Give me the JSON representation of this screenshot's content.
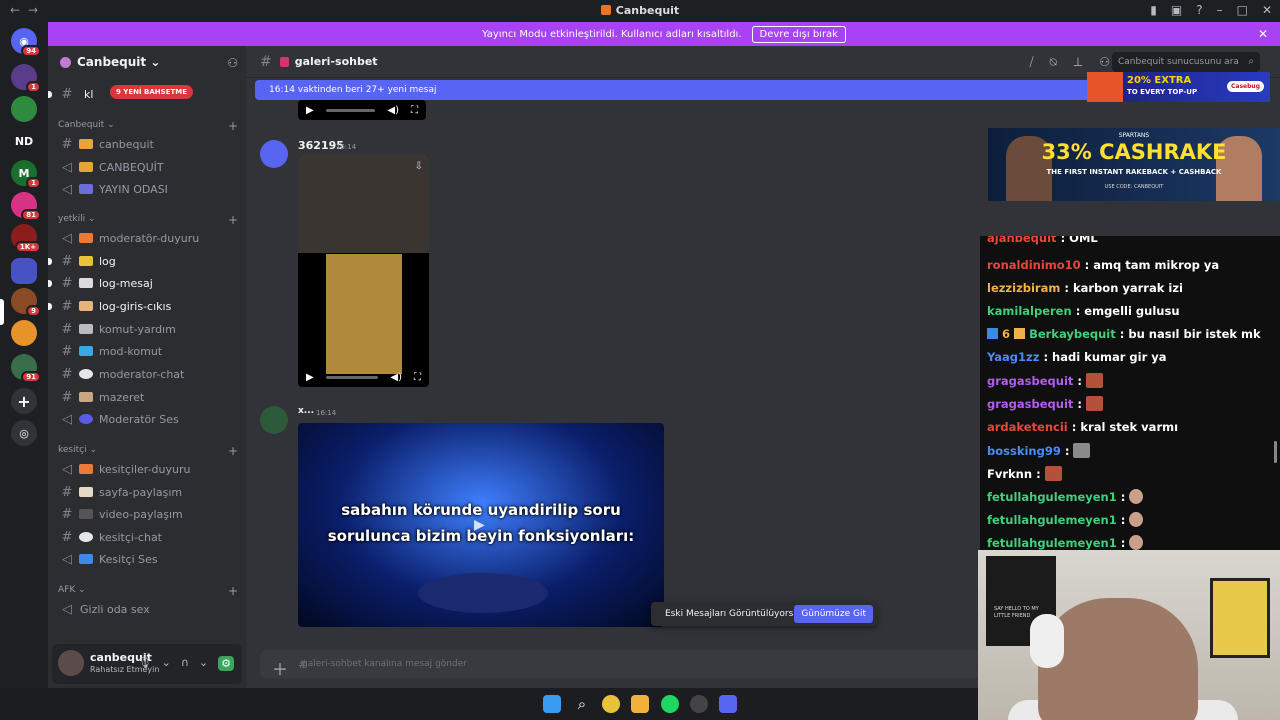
{
  "window": {
    "title": "Canbequit"
  },
  "banner": {
    "text": "Yayıncı Modu etkinleştirildi. Kullanıcı adları kısaltıldı.",
    "button": "Devre dışı bırak"
  },
  "rail": {
    "badges": [
      "94",
      "1",
      "1",
      "81",
      "1K+",
      "9",
      "91"
    ],
    "nd_label": "ND"
  },
  "server": {
    "name": "Canbequit",
    "new_badge": "9 YENİ BAHSETME",
    "first_channel_stub": "kl",
    "categories": [
      {
        "name": "Canbequit",
        "channels": [
          "canbequit",
          "CANBEQUİT",
          "YAYIN ODASI"
        ]
      },
      {
        "name": "yetkili",
        "channels": [
          "moderatör-duyuru",
          "log",
          "log-mesaj",
          "log-giris-cıkıs",
          "komut-yardım",
          "mod-komut",
          "moderator-chat",
          "mazeret",
          "Moderatör Ses"
        ]
      },
      {
        "name": "kesitçi",
        "channels": [
          "kesitçiler-duyuru",
          "sayfa-paylaşım",
          "video-paylaşım",
          "kesitçi-chat",
          "Kesitçi Ses"
        ]
      },
      {
        "name": "AFK",
        "channels": [
          "Gizli oda sex"
        ]
      }
    ]
  },
  "user": {
    "name": "canbequit",
    "status": "Rahatsız Etmeyin"
  },
  "channel": {
    "name": "galeri-sohbet",
    "search_placeholder": "Canbequit sunucusunu ara",
    "new_messages_bar": "16:14 vaktinden beri 27+ yeni mesaj"
  },
  "messages": [
    {
      "author": "362195",
      "time": "16:14"
    },
    {
      "author": "x...",
      "time": "16:14",
      "video_caption": "sabahın körunde uyandirilip soru sorulunca bizim beyin fonksiyonları:"
    }
  ],
  "jump": {
    "text": "Eski Mesajları Görüntülüyorsun",
    "button": "Günümüze Git"
  },
  "composer": {
    "placeholder": "galeri-sohbet kanalına mesaj gönder"
  },
  "ads": {
    "top": {
      "headline": "20% EXTRA",
      "sub": "TO EVERY TOP-UP",
      "brand": "Casebug"
    },
    "main": {
      "brand": "SPARTANS",
      "headline": "33% CASHRAKE",
      "sub": "THE FIRST INSTANT RAKEBACK + CASHBACK",
      "code": "USE CODE: CANBEQUIT"
    }
  },
  "chat": [
    {
      "user": "ajanbequit",
      "msg": ": OML",
      "color": "#e8483b"
    },
    {
      "user": "ronaldinimo10",
      "msg": ": amq tam mikrop ya",
      "color": "#e8483b"
    },
    {
      "user": "lezzizbiram",
      "msg": ": karbon yarrak izi",
      "color": "#f0b24a"
    },
    {
      "user": "kamilalperen",
      "msg": ": emgelli gulusu",
      "color": "#3fd17a"
    },
    {
      "user": "Berkaybequit",
      "msg": ": bu nasıl bir istek mk",
      "color": "#3fd17a",
      "prefix": "6"
    },
    {
      "user": "Yaag1zz",
      "msg": ": hadi kumar gir ya",
      "color": "#4a8cf7"
    },
    {
      "user": "gragasbequit",
      "msg": ":",
      "color": "#b25df0",
      "emote": "sq"
    },
    {
      "user": "gragasbequit",
      "msg": ":",
      "color": "#b25df0",
      "emote": "sq"
    },
    {
      "user": "ardaketencii",
      "msg": ": kral stek varmı",
      "color": "#e8483b"
    },
    {
      "user": "bossking99",
      "msg": ":",
      "color": "#4a8cf7",
      "emote": "sq"
    },
    {
      "user": "Fvrknn",
      "msg": ":",
      "color": "#ffffff",
      "emote": "sq"
    },
    {
      "user": "fetullahgulemeyen1",
      "msg": ":",
      "color": "#3fd17a",
      "emote": "face"
    },
    {
      "user": "fetullahgulemeyen1",
      "msg": ":",
      "color": "#3fd17a",
      "emote": "face"
    },
    {
      "user": "fetullahgulemeyen1",
      "msg": ":",
      "color": "#3fd17a",
      "emote": "face"
    }
  ],
  "webcam": {
    "poster_text": "SAY HELLO TO MY LITTLE FRIEND"
  },
  "colors": {
    "accent": "#5865f2",
    "banner": "#a742f5",
    "dnd": "#da373c"
  }
}
